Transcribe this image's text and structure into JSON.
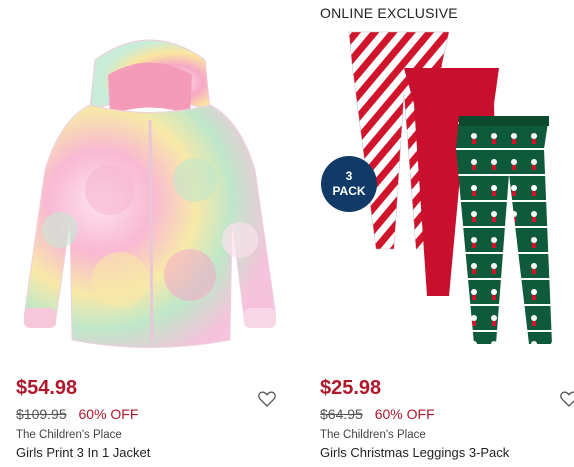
{
  "products": [
    {
      "flag": "",
      "price": "$54.98",
      "was_price": "$109.95",
      "discount": "60% OFF",
      "brand": "The Children's Place",
      "name": "Girls Print 3 In 1 Jacket",
      "image_icon": "tie-dye-hooded-jacket-image"
    },
    {
      "flag": "ONLINE EXCLUSIVE",
      "badge": "3\nPACK",
      "price": "$25.98",
      "was_price": "$64.95",
      "discount": "60% OFF",
      "brand": "The Children's Place",
      "name": "Girls Christmas Leggings 3-Pack",
      "image_icon": "christmas-leggings-image"
    }
  ],
  "colors": {
    "sale_price": "#b0182c",
    "badge_bg": "#123a66",
    "leggings_red": "#c8102e",
    "leggings_green": "#0f5a3a"
  },
  "icons": {
    "favorite": "heart-outline-icon"
  }
}
